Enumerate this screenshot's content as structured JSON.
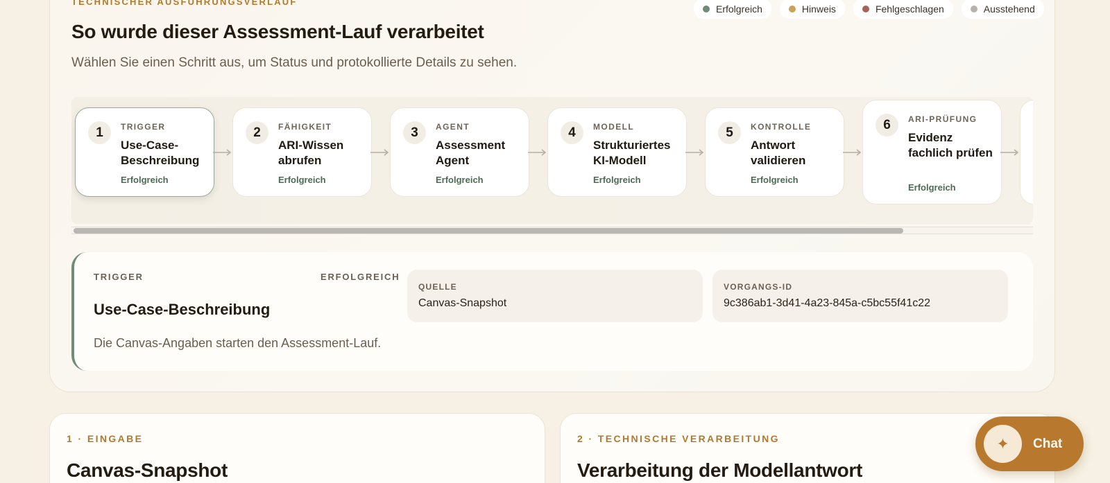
{
  "header": {
    "eyebrow": "TECHNISCHER AUSFÜHRUNGSVERLAUF",
    "title": "So wurde dieser Assessment-Lauf verarbeitet",
    "subtitle": "Wählen Sie einen Schritt aus, um Status und protokollierte Details zu sehen."
  },
  "legend": [
    {
      "label": "Erfolgreich",
      "color": "#6f8c77"
    },
    {
      "label": "Hinweis",
      "color": "#c9a15a"
    },
    {
      "label": "Fehlgeschlagen",
      "color": "#a8625a"
    },
    {
      "label": "Ausstehend",
      "color": "#b5b2ac"
    }
  ],
  "steps": [
    {
      "number": "1",
      "kind": "TRIGGER",
      "title": "Use-Case-Beschreibung",
      "status": "Erfolgreich",
      "active": true
    },
    {
      "number": "2",
      "kind": "FÄHIGKEIT",
      "title": "ARI-Wissen abrufen",
      "status": "Erfolgreich"
    },
    {
      "number": "3",
      "kind": "AGENT",
      "title": "Assessment Agent",
      "status": "Erfolgreich"
    },
    {
      "number": "4",
      "kind": "MODELL",
      "title": "Strukturiertes KI-Modell",
      "status": "Erfolgreich"
    },
    {
      "number": "5",
      "kind": "KONTROLLE",
      "title": "Antwort validieren",
      "status": "Erfolgreich"
    },
    {
      "number": "6",
      "kind": "ARI-PRÜFUNG",
      "title": "Evidenz fachlich prüfen",
      "status": "Erfolgreich"
    }
  ],
  "detail": {
    "kind": "TRIGGER",
    "status": "ERFOLGREICH",
    "title": "Use-Case-Beschreibung",
    "description": "Die Canvas-Angaben starten den Assessment-Lauf.",
    "source_label": "QUELLE",
    "source_value": "Canvas-Snapshot",
    "id_label": "VORGANGS-ID",
    "id_value": "9c386ab1-3d41-4a23-845a-c5bc55f41c22"
  },
  "cards": [
    {
      "eyebrow": "1 · EINGABE",
      "title": "Canvas-Snapshot"
    },
    {
      "eyebrow": "2 · TECHNISCHE VERARBEITUNG",
      "title": "Verarbeitung der Modellantwort"
    }
  ],
  "chat": {
    "label": "Chat",
    "icon": "sparkle-icon"
  }
}
